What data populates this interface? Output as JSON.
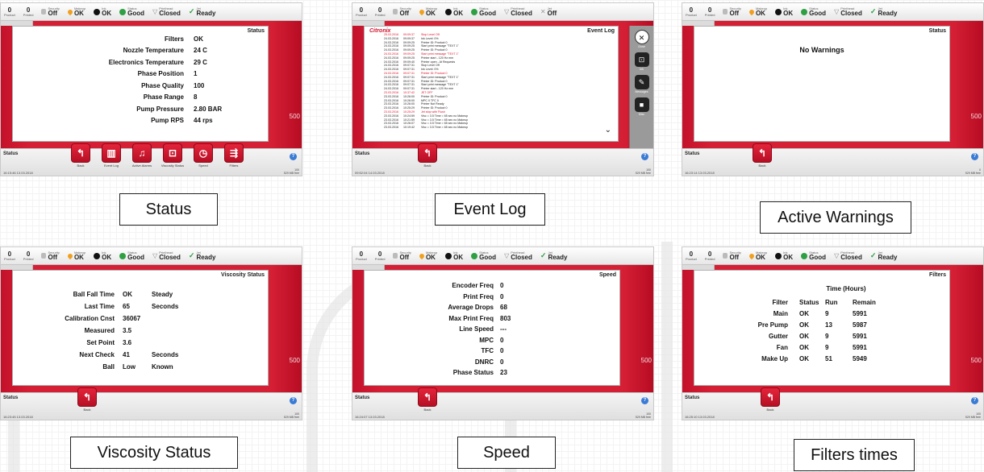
{
  "topbar": {
    "product": {
      "value": "0",
      "label": "Product"
    },
    "printed": {
      "value": "0",
      "label": "Printed"
    },
    "security": {
      "label": "Security",
      "value": "Off"
    },
    "makeup": {
      "label": "Makeup",
      "value": "OK"
    },
    "ink": {
      "label": "Ink",
      "value": "OK"
    },
    "status": {
      "label": "Status",
      "value": "Good"
    },
    "printhead": {
      "label": "Printhead",
      "value": "Closed"
    },
    "jet": {
      "label": "Jet",
      "value": "Ready"
    },
    "jet_off": {
      "label": "Jet",
      "value": "Off"
    }
  },
  "side_number": "500",
  "screens": {
    "status": {
      "title": "Status",
      "rows": [
        {
          "k": "Filters",
          "v": "OK"
        },
        {
          "k": "Nozzle Temperature",
          "v": "24 C"
        },
        {
          "k": "Electronics Temperature",
          "v": "29 C"
        },
        {
          "k": "Phase Position",
          "v": "1"
        },
        {
          "k": "Phase Quality",
          "v": "100"
        },
        {
          "k": "Phase Range",
          "v": "8"
        },
        {
          "k": "Pump Pressure",
          "v": "2.80 BAR"
        },
        {
          "k": "Pump RPS",
          "v": "44 rps"
        }
      ],
      "bottom_title": "Status",
      "time": "16:15:46   13.03.2018",
      "right_info": [
        "100",
        "529 MB free"
      ],
      "buttons": [
        {
          "label": "Back",
          "icon": "↰"
        },
        {
          "label": "Event Log",
          "icon": "▥"
        },
        {
          "label": "Active Alarms",
          "icon": "♫"
        },
        {
          "label": "Viscosity Status",
          "icon": "⊡"
        },
        {
          "label": "Speed",
          "icon": "◷"
        },
        {
          "label": "Filters",
          "icon": "⇶"
        }
      ]
    },
    "event_log": {
      "title": "Event Log",
      "logo": "Citronix",
      "bottom_title": "Status",
      "time": "09:52:04   14.03.2018",
      "back_label": "Back",
      "right_info": [
        "100",
        "529 MB free"
      ],
      "side_buttons": [
        "Close",
        "Ink",
        "Messages",
        "Misc"
      ],
      "rows": [
        {
          "d": "25.03.2016",
          "t": "09:09:37",
          "m": "Stop Level Off",
          "red": true
        },
        {
          "d": "24.03.2016",
          "t": "09:09:37",
          "m": "Ink Level: 0%",
          "red": false
        },
        {
          "d": "24.03.2016",
          "t": "09:09:25",
          "m": "Printer ID: Product 0",
          "red": false
        },
        {
          "d": "24.03.2016",
          "t": "09:09:25",
          "m": "Start print message \"TEXT 1\"",
          "red": false
        },
        {
          "d": "24.03.2016",
          "t": "09:09:25",
          "m": "Printer ID: Product 0",
          "red": false
        },
        {
          "d": "24.03.2016",
          "t": "09:09:25",
          "m": "Start print message \"TEXT 1\"",
          "red": true
        },
        {
          "d": "24.03.2016",
          "t": "09:09:25",
          "m": "Printer start - 120 Hz mm",
          "red": false
        },
        {
          "d": "24.03.2016",
          "t": "09:09:40",
          "m": "Printer open - At Requests",
          "red": false
        },
        {
          "d": "24.03.2016",
          "t": "09:07:31",
          "m": "Stop Level Off",
          "red": false
        },
        {
          "d": "24.03.2016",
          "t": "09:07:31",
          "m": "Ink Level: 0%",
          "red": false
        },
        {
          "d": "24.03.2016",
          "t": "09:07:31",
          "m": "Printer ID: Product 0",
          "red": true
        },
        {
          "d": "24.03.2016",
          "t": "09:07:31",
          "m": "Start print message \"TEXT 1\"",
          "red": false
        },
        {
          "d": "24.03.2016",
          "t": "09:07:31",
          "m": "Printer ID: Product 0",
          "red": false
        },
        {
          "d": "24.03.2016",
          "t": "09:07:31",
          "m": "Start print message \"TEXT 1\"",
          "red": false
        },
        {
          "d": "24.03.2016",
          "t": "09:07:31",
          "m": "Printer start - 120 Hz mm",
          "red": false
        },
        {
          "d": "23.03.2016",
          "t": "10:37:42",
          "m": "JET OFF",
          "red": true
        },
        {
          "d": "23.03.2016",
          "t": "10:26:00",
          "m": "Printer ID: Product 0",
          "red": false
        },
        {
          "d": "23.03.2016",
          "t": "10:26:00",
          "m": "MPC 0   TFC 0",
          "red": false
        },
        {
          "d": "23.03.2016",
          "t": "10:26:00",
          "m": "Printer Not Ready",
          "red": false
        },
        {
          "d": "23.03.2016",
          "t": "10:25:29",
          "m": "Printer ID: Product 0",
          "red": false
        },
        {
          "d": "23.03.2016",
          "t": "10:25:29",
          "m": "Jet stop with Flush",
          "red": true
        },
        {
          "d": "23.03.2016",
          "t": "10:24:59",
          "m": "Visc = 3.5  Time = 65 sec  no Makeup",
          "red": false
        },
        {
          "d": "23.03.2016",
          "t": "10:21:59",
          "m": "Visc = 3.5  Time = 65 sec  no Makeup",
          "red": false
        },
        {
          "d": "23.03.2016",
          "t": "10:26:07",
          "m": "Visc = 3.5  Time = 65 sec  no Makeup",
          "red": false
        },
        {
          "d": "23.03.2016",
          "t": "10:19:42",
          "m": "Visc = 3.5  Time = 65 sec  no Makeup",
          "red": false
        }
      ]
    },
    "warnings": {
      "title": "Status",
      "message": "No Warnings",
      "bottom_title": "Status",
      "time": "16:23:14   13.03.2018",
      "back_label": "Back",
      "right_info": [
        "0",
        "529 MB free"
      ]
    },
    "viscosity": {
      "title": "Viscosity Status",
      "rows": [
        {
          "k": "Ball Fall Time",
          "v": "OK",
          "u": "Steady"
        },
        {
          "k": "Last Time",
          "v": "65",
          "u": "Seconds"
        },
        {
          "k": "Calibration Cnst",
          "v": "36067",
          "u": ""
        },
        {
          "k": "Measured",
          "v": "3.5",
          "u": ""
        },
        {
          "k": "Set Point",
          "v": "3.6",
          "u": ""
        },
        {
          "k": "Next Check",
          "v": "41",
          "u": "Seconds"
        },
        {
          "k": "Ball",
          "v": "Low",
          "u": "Known"
        }
      ],
      "bottom_title": "Status",
      "time": "16:23:45   13.03.2018",
      "back_label": "Back",
      "right_info": [
        "100",
        "529 MB free"
      ]
    },
    "speed": {
      "title": "Speed",
      "rows": [
        {
          "k": "Encoder Freq",
          "v": "0"
        },
        {
          "k": "Print Freq",
          "v": "0"
        },
        {
          "k": "Average Drops",
          "v": "68"
        },
        {
          "k": "Max Print Freq",
          "v": "803"
        },
        {
          "k": "Line Speed",
          "v": "---"
        },
        {
          "k": "MPC",
          "v": "0"
        },
        {
          "k": "TFC",
          "v": "0"
        },
        {
          "k": "DNRC",
          "v": "0"
        },
        {
          "k": "Phase Status",
          "v": "23"
        }
      ],
      "bottom_title": "Status",
      "time": "16:24:07   13.03.2018",
      "back_label": "Back",
      "right_info": [
        "100",
        "529 MB free"
      ]
    },
    "filters": {
      "title": "Filters",
      "time_header": "Time (Hours)",
      "columns": [
        "Filter",
        "Status",
        "Run",
        "Remain"
      ],
      "rows": [
        [
          "Main",
          "OK",
          "9",
          "5991"
        ],
        [
          "Pre Pump",
          "OK",
          "13",
          "5987"
        ],
        [
          "Gutter",
          "OK",
          "9",
          "5991"
        ],
        [
          "Fan",
          "OK",
          "9",
          "5991"
        ],
        [
          "Make Up",
          "OK",
          "51",
          "5949"
        ]
      ],
      "bottom_title": "Status",
      "time": "16:25:10   13.03.2018",
      "back_label": "Back",
      "right_info": [
        "100",
        "529 MB free"
      ]
    }
  },
  "captions": {
    "status": "Status",
    "event_log": "Event Log",
    "warnings": "Active Warnings",
    "viscosity": "Viscosity Status",
    "speed": "Speed",
    "filters": "Filters times"
  }
}
